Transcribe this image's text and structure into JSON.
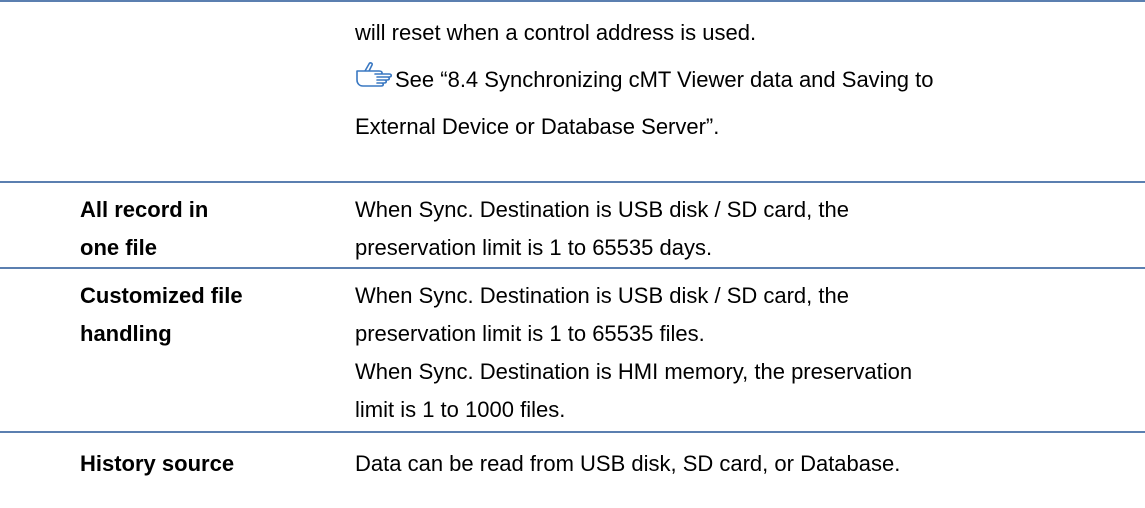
{
  "row_continuation": {
    "lines": [
      "will reset when a control address is used."
    ],
    "reference": {
      "icon": "pointing-hand-icon",
      "line1": "See “8.4 Synchronizing cMT Viewer data and Saving to",
      "line2": "External Device or Database Server”."
    }
  },
  "rows": [
    {
      "label_lines": [
        "All record in",
        "one file"
      ],
      "desc_lines": [
        "When Sync. Destination is USB disk / SD card, the",
        "preservation limit is 1 to 65535 days."
      ]
    },
    {
      "label_lines": [
        "Customized file",
        "handling"
      ],
      "desc_lines": [
        "When Sync. Destination is USB disk / SD card, the",
        "preservation limit is 1 to 65535 files.",
        "When Sync. Destination is HMI memory, the preservation",
        "limit is 1 to 1000 files."
      ]
    },
    {
      "label_lines": [
        "History source"
      ],
      "desc_lines": [
        "Data can be read from USB disk, SD card, or Database."
      ]
    }
  ],
  "colors": {
    "rule": "#5b7fb0",
    "icon_stroke": "#3a78c2"
  }
}
